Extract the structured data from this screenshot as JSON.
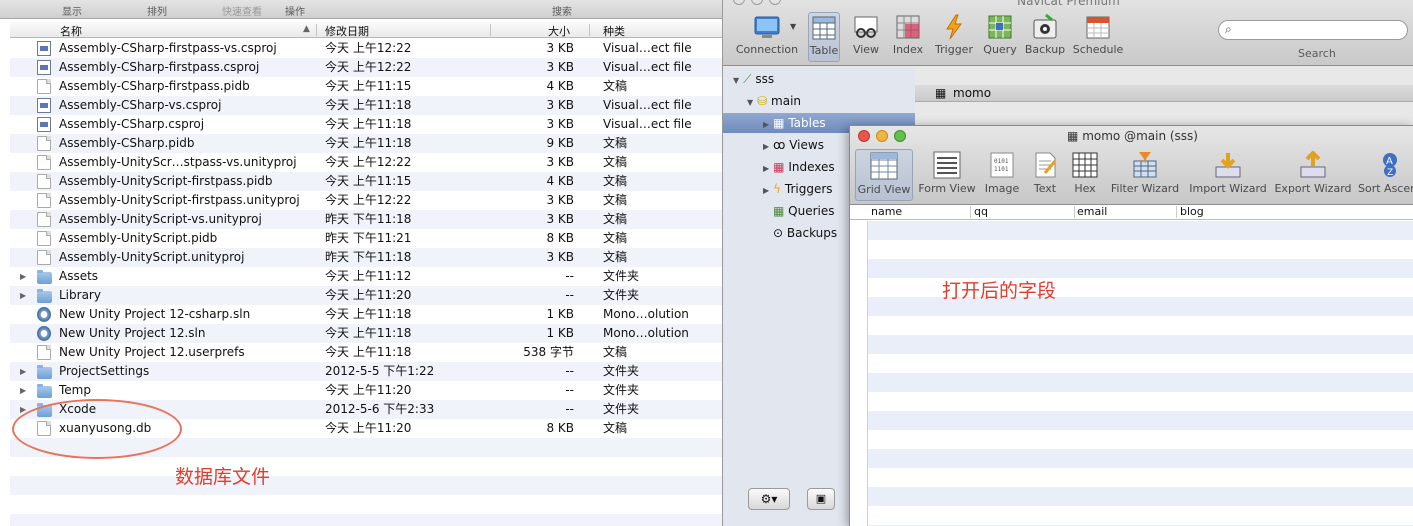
{
  "finder": {
    "toolbar": {
      "show": "显示",
      "arrange": "排列",
      "quicklook": "快速查看",
      "action": "操作",
      "search": "搜索"
    },
    "columns": {
      "name": "名称",
      "date": "修改日期",
      "size": "大小",
      "kind": "种类"
    },
    "files": [
      {
        "name": "Assembly-CSharp-firstpass-vs.csproj",
        "date": "今天 上午12:22",
        "size": "3 KB",
        "kind": "Visual…ect file",
        "icon": "project-file-icon",
        "expandable": false
      },
      {
        "name": "Assembly-CSharp-firstpass.csproj",
        "date": "今天 上午12:22",
        "size": "3 KB",
        "kind": "Visual…ect file",
        "icon": "project-file-icon",
        "expandable": false
      },
      {
        "name": "Assembly-CSharp-firstpass.pidb",
        "date": "今天 上午11:15",
        "size": "4 KB",
        "kind": "文稿",
        "icon": "document-icon",
        "expandable": false
      },
      {
        "name": "Assembly-CSharp-vs.csproj",
        "date": "今天 上午11:18",
        "size": "3 KB",
        "kind": "Visual…ect file",
        "icon": "project-file-icon",
        "expandable": false
      },
      {
        "name": "Assembly-CSharp.csproj",
        "date": "今天 上午11:18",
        "size": "3 KB",
        "kind": "Visual…ect file",
        "icon": "project-file-icon",
        "expandable": false
      },
      {
        "name": "Assembly-CSharp.pidb",
        "date": "今天 上午11:18",
        "size": "9 KB",
        "kind": "文稿",
        "icon": "document-icon",
        "expandable": false
      },
      {
        "name": "Assembly-UnityScr…stpass-vs.unityproj",
        "date": "今天 上午12:22",
        "size": "3 KB",
        "kind": "文稿",
        "icon": "document-icon",
        "expandable": false
      },
      {
        "name": "Assembly-UnityScript-firstpass.pidb",
        "date": "今天 上午11:15",
        "size": "4 KB",
        "kind": "文稿",
        "icon": "document-icon",
        "expandable": false
      },
      {
        "name": "Assembly-UnityScript-firstpass.unityproj",
        "date": "今天 上午12:22",
        "size": "3 KB",
        "kind": "文稿",
        "icon": "document-icon",
        "expandable": false
      },
      {
        "name": "Assembly-UnityScript-vs.unityproj",
        "date": "昨天 下午11:18",
        "size": "3 KB",
        "kind": "文稿",
        "icon": "document-icon",
        "expandable": false
      },
      {
        "name": "Assembly-UnityScript.pidb",
        "date": "昨天 下午11:21",
        "size": "8 KB",
        "kind": "文稿",
        "icon": "document-icon",
        "expandable": false
      },
      {
        "name": "Assembly-UnityScript.unityproj",
        "date": "昨天 下午11:18",
        "size": "3 KB",
        "kind": "文稿",
        "icon": "document-icon",
        "expandable": false
      },
      {
        "name": "Assets",
        "date": "今天 上午11:12",
        "size": "--",
        "kind": "文件夹",
        "icon": "folder-icon",
        "expandable": true
      },
      {
        "name": "Library",
        "date": "今天 上午11:20",
        "size": "--",
        "kind": "文件夹",
        "icon": "folder-icon",
        "expandable": true
      },
      {
        "name": "New Unity Project 12-csharp.sln",
        "date": "今天 上午11:18",
        "size": "1 KB",
        "kind": "Mono…olution",
        "icon": "solution-icon",
        "expandable": false
      },
      {
        "name": "New Unity Project 12.sln",
        "date": "今天 上午11:18",
        "size": "1 KB",
        "kind": "Mono…olution",
        "icon": "solution-icon",
        "expandable": false
      },
      {
        "name": "New Unity Project 12.userprefs",
        "date": "今天 上午11:18",
        "size": "538 字节",
        "kind": "文稿",
        "icon": "document-icon",
        "expandable": false
      },
      {
        "name": "ProjectSettings",
        "date": "2012-5-5 下午1:22",
        "size": "--",
        "kind": "文件夹",
        "icon": "folder-icon",
        "expandable": true
      },
      {
        "name": "Temp",
        "date": "今天 上午11:20",
        "size": "--",
        "kind": "文件夹",
        "icon": "folder-icon",
        "expandable": true
      },
      {
        "name": "Xcode",
        "date": "2012-5-6 下午2:33",
        "size": "--",
        "kind": "文件夹",
        "icon": "folder-icon",
        "expandable": true
      },
      {
        "name": "xuanyusong.db",
        "date": "今天 上午11:20",
        "size": "8 KB",
        "kind": "文稿",
        "icon": "document-icon",
        "expandable": false
      }
    ],
    "annotation": "数据库文件"
  },
  "navicat": {
    "title": "Navicat Premium",
    "toolbar": [
      "Connection",
      "Table",
      "View",
      "Index",
      "Trigger",
      "Query",
      "Backup",
      "Schedule"
    ],
    "search_label": "Search",
    "tree": {
      "connection": "sss",
      "database": "main",
      "items": [
        "Tables",
        "Views",
        "Indexes",
        "Triggers",
        "Queries",
        "Backups"
      ]
    },
    "table_item": "momo",
    "window": {
      "title": "momo @main (sss)",
      "toolbar": [
        "Grid View",
        "Form View",
        "Image",
        "Text",
        "Hex",
        "Filter Wizard",
        "Import Wizard",
        "Export Wizard",
        "Sort Ascen"
      ],
      "columns": [
        "name",
        "qq",
        "email",
        "blog"
      ],
      "annotation": "打开后的字段"
    },
    "colors": {
      "accent": "#6f8bbd",
      "annotation": "#e23c2c",
      "stripe": "#e9eef8"
    }
  }
}
